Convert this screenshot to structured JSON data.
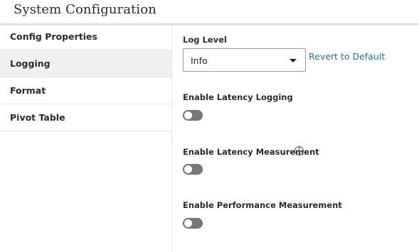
{
  "header": {
    "title": "System Configuration"
  },
  "sidebar": {
    "items": [
      {
        "label": "Config Properties",
        "active": false
      },
      {
        "label": "Logging",
        "active": true
      },
      {
        "label": "Format",
        "active": false
      },
      {
        "label": "Pivot Table",
        "active": false
      }
    ]
  },
  "main": {
    "log_level": {
      "label": "Log Level",
      "value": "Info",
      "revert_label": "Revert to Default"
    },
    "latency_logging": {
      "label": "Enable Latency Logging",
      "enabled": false
    },
    "latency_measurement": {
      "label": "Enable Latency Measurement",
      "enabled": false,
      "help_icon": "question-circle-icon"
    },
    "performance_measurement": {
      "label": "Enable Performance Measurement",
      "enabled": false
    }
  },
  "colors": {
    "link": "#2a6f8f",
    "toggle_off": "#7a7672",
    "active_nav_bg": "#f1f0ee"
  }
}
